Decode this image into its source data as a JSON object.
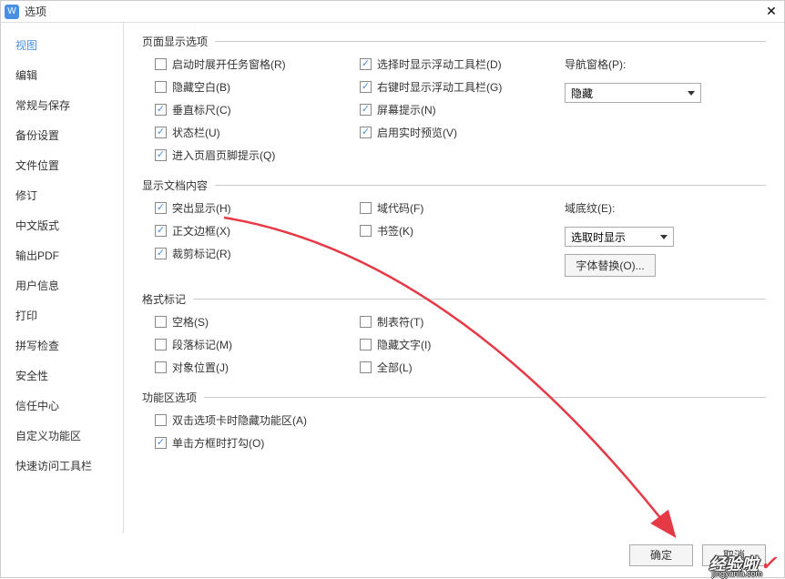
{
  "titlebar": {
    "icon_letter": "W",
    "title": "选项"
  },
  "sidebar": {
    "items": [
      {
        "label": "视图",
        "active": true
      },
      {
        "label": "编辑"
      },
      {
        "label": "常规与保存"
      },
      {
        "label": "备份设置"
      },
      {
        "label": "文件位置"
      },
      {
        "label": "修订"
      },
      {
        "label": "中文版式"
      },
      {
        "label": "输出PDF"
      },
      {
        "label": "用户信息"
      },
      {
        "label": "打印"
      },
      {
        "label": "拼写检查"
      },
      {
        "label": "安全性"
      },
      {
        "label": "信任中心"
      },
      {
        "label": "自定义功能区"
      },
      {
        "label": "快速访问工具栏"
      }
    ]
  },
  "sections": {
    "page_display": {
      "legend": "页面显示选项",
      "items_col1": [
        {
          "label": "启动时展开任务窗格(R)",
          "checked": false
        },
        {
          "label": "隐藏空白(B)",
          "checked": false
        },
        {
          "label": "垂直标尺(C)",
          "checked": true
        },
        {
          "label": "状态栏(U)",
          "checked": true
        },
        {
          "label": "进入页眉页脚提示(Q)",
          "checked": true
        }
      ],
      "items_col2": [
        {
          "label": "选择时显示浮动工具栏(D)",
          "checked": true
        },
        {
          "label": "右键时显示浮动工具栏(G)",
          "checked": true
        },
        {
          "label": "屏幕提示(N)",
          "checked": true
        },
        {
          "label": "启用实时预览(V)",
          "checked": true
        }
      ],
      "nav_pane_label": "导航窗格(P):",
      "nav_pane_value": "隐藏"
    },
    "doc_content": {
      "legend": "显示文档内容",
      "items_col1": [
        {
          "label": "突出显示(H)",
          "checked": true
        },
        {
          "label": "正文边框(X)",
          "checked": true
        },
        {
          "label": "裁剪标记(R)",
          "checked": true
        }
      ],
      "items_col2": [
        {
          "label": "域代码(F)",
          "checked": false
        },
        {
          "label": "书签(K)",
          "checked": false
        }
      ],
      "shading_label": "域底纹(E):",
      "shading_value": "选取时显示",
      "font_sub_btn": "字体替换(O)..."
    },
    "format_marks": {
      "legend": "格式标记",
      "items_col1": [
        {
          "label": "空格(S)",
          "checked": false
        },
        {
          "label": "段落标记(M)",
          "checked": false
        },
        {
          "label": "对象位置(J)",
          "checked": false
        }
      ],
      "items_col2": [
        {
          "label": "制表符(T)",
          "checked": false
        },
        {
          "label": "隐藏文字(I)",
          "checked": false
        },
        {
          "label": "全部(L)",
          "checked": false
        }
      ]
    },
    "ribbon": {
      "legend": "功能区选项",
      "items": [
        {
          "label": "双击选项卡时隐藏功能区(A)",
          "checked": false
        },
        {
          "label": "单击方框时打勾(O)",
          "checked": true
        }
      ]
    }
  },
  "footer": {
    "ok": "确定",
    "cancel": "取消"
  },
  "watermark": {
    "main": "经验啦",
    "sub": "jingyanla.com"
  }
}
